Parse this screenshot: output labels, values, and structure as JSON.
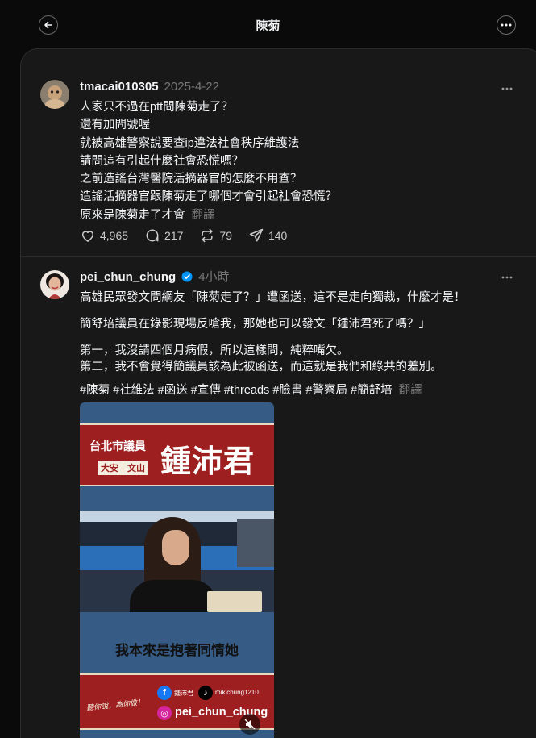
{
  "header": {
    "title": "陳菊",
    "back_icon": "arrow-left-icon",
    "more_icon": "more-horizontal-icon"
  },
  "posts": [
    {
      "username": "tmacai010305",
      "date": "2025-4-22",
      "lines": [
        "人家只不過在ptt問陳菊走了？",
        "還有加問號喔",
        "就被高雄警察說要查ip違法社會秩序維護法",
        "請問這有引起什麼社會恐慌嗎？",
        "之前造謠台灣醫院活摘器官的怎麼不用查？",
        "造謠活摘器官跟陳菊走了哪個才會引起社會恐慌？",
        "原來是陳菊走了才會"
      ],
      "translate": "翻譯",
      "likes": "4,965",
      "comments": "217",
      "reposts": "79",
      "shares": "140"
    },
    {
      "username": "pei_chun_chung",
      "time": "4小時",
      "verified_color": "#0095f6",
      "lines": [
        "高雄民眾發文問網友「陳菊走了？」遭函送，這不是走向獨裁，什麼才是！",
        "簡舒培議員在錄影現場反嗆我，那她也可以發文「鍾沛君死了嗎？」",
        "第一，我沒請四個月病假，所以這樣問，純粹嘴欠。",
        "第二，我不會覺得簡議員該為此被函送，而這就是我們和綠共的差別。",
        "#陳菊 #社維法 #函送 #宣傳 #threads #臉書 #警察局 #簡舒培"
      ],
      "translate": "翻譯",
      "media": {
        "role": "台北市議員",
        "district": "大安｜文山",
        "name": "鍾沛君",
        "caption": "我本來是抱著同情她",
        "fb_handle": "鍾沛君",
        "tiktok_handle": "mikichung1210",
        "ig_handle": "pei_chun_chung",
        "signature": "聽你說，為你做！"
      }
    }
  ]
}
